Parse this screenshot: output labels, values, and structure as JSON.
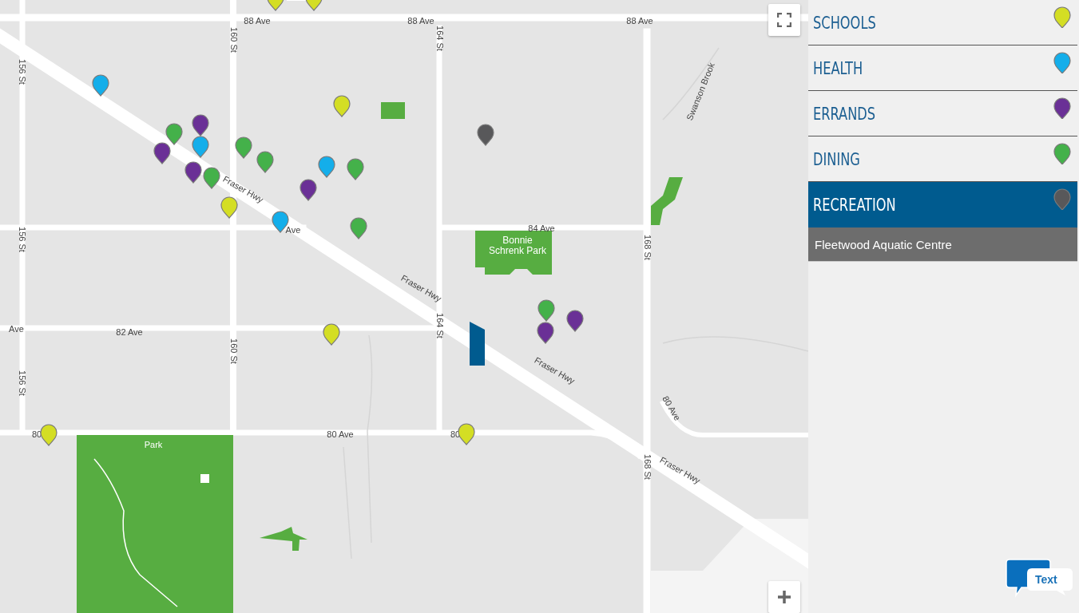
{
  "map": {
    "labels": [
      "88 Ave",
      "88 Ave",
      "88 Ave",
      "84 Ave",
      "Ave",
      "82 Ave",
      "80",
      "80 Ave",
      "80",
      "156 St",
      "156 St",
      "156 St",
      "160 St",
      "160 St",
      "164 St",
      "164 St",
      "168 St",
      "168 St",
      "Fraser Hwy",
      "Fraser Hwy",
      "Fraser Hwy",
      "Fraser Hwy",
      "Swanson Brook",
      "Bonnie Schrenk Park",
      "Park",
      "80 Ave",
      "Ave"
    ]
  },
  "categories": [
    {
      "label": "SCHOOLS",
      "color": "#d4de24",
      "selected": false
    },
    {
      "label": "HEALTH",
      "color": "#14aeea",
      "selected": false
    },
    {
      "label": "ERRANDS",
      "color": "#6a3096",
      "selected": false
    },
    {
      "label": "DINING",
      "color": "#44b14a",
      "selected": false
    },
    {
      "label": "RECREATION",
      "color": "#58585a",
      "selected": true,
      "places": [
        "Fleetwood Aquatic Centre"
      ]
    }
  ],
  "chat_button": {
    "label": "Text"
  }
}
